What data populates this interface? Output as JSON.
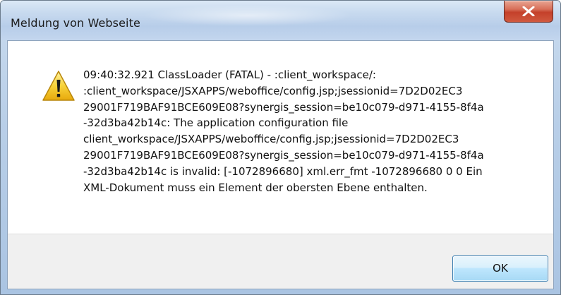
{
  "window": {
    "title": "Meldung von Webseite"
  },
  "dialog": {
    "icon": "warning-icon",
    "message": "09:40:32.921 ClassLoader (FATAL) - :client_workspace/:\n:client_workspace/JSXAPPS/weboffice/config.jsp;jsessionid=7D2D02EC3\n29001F719BAF91BCE609E08?synergis_session=be10c079-d971-4155-8f4a\n-32d3ba42b14c: The application configuration file\nclient_workspace/JSXAPPS/weboffice/config.jsp;jsessionid=7D2D02EC3\n29001F719BAF91BCE609E08?synergis_session=be10c079-d971-4155-8f4a\n-32d3ba42b14c is invalid: [-1072896680] xml.err_fmt -1072896680 0 0 Ein\nXML-Dokument muss ein Element der obersten Ebene enthalten.",
    "ok_label": "OK"
  },
  "colors": {
    "close_button": "#c4402a",
    "warning_fill": "#f5c518",
    "ok_border": "#3c7fb1"
  }
}
